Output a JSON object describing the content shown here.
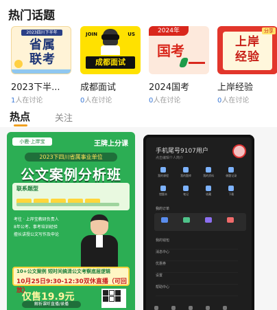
{
  "hot_topics": {
    "title": "热门话题",
    "items": [
      {
        "name": "2023下半...",
        "count": "1",
        "suffix": "人在讨论",
        "thumb": {
          "top": "2023四川下半年",
          "line1": "省属",
          "line2": "联考"
        }
      },
      {
        "name": "成都面试",
        "count": "0",
        "suffix": "人在讨论",
        "thumb": {
          "left": "JOIN",
          "right": "US",
          "label": "成都面试"
        }
      },
      {
        "name": "2024国考",
        "count": "0",
        "suffix": "人在讨论",
        "thumb": {
          "year": "2024年",
          "main": "国考"
        }
      },
      {
        "name": "上岸经验",
        "count": "0",
        "suffix": "人在讨论",
        "thumb": {
          "tag": "分享",
          "line1": "上岸",
          "line2": "经验"
        }
      }
    ]
  },
  "tabs": {
    "active": "热点",
    "inactive": "关注"
  },
  "posts": {
    "poster": {
      "brand": "小鹿·上岸宝",
      "slogan": "王牌上分课",
      "subtitle": "2023下四川省属事业单位",
      "title": "公文案例分析班",
      "bar_title": "联系题型",
      "teacher_text": "考往 · 上岸宝教研负责人\n8年公考、事考培训经验\n擅长讲授公文写作及申论",
      "date_line1": "10+公文案例  短时间搞清公文考察底层逻辑",
      "date_line2": "10月25日9:30-12:30双休直播（可回放）",
      "price": "仅售19.9元",
      "price_sub": "解析课听直播/录播"
    },
    "phone": {
      "user": "手机尾号9107用户",
      "user_sub": "点击编辑个人简介",
      "grid": [
        "我的课程",
        "我的题库",
        "我的资料",
        "做题记录",
        "错题本",
        "笔记",
        "收藏",
        "下载"
      ],
      "orders_title": "我的订单",
      "menu": [
        "我的钱包",
        "消息中心",
        "优惠券",
        "设置",
        "帮助中心"
      ]
    }
  },
  "colors": {
    "accent_underline": "#f0a020",
    "discussion_count": "#3a78d6",
    "poster_green": "#2cae54"
  }
}
